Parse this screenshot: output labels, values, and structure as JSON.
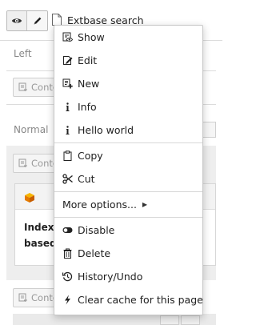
{
  "toolbar": {
    "page_title": "Extbase search",
    "buttons": [
      "eye-icon",
      "pencil-icon"
    ]
  },
  "columns": {
    "left_label": "Left",
    "normal_label": "Normal",
    "content_button_label": "Content"
  },
  "element": {
    "text_line1": "Indexe",
    "text_line2": "based"
  },
  "context_menu": {
    "items": [
      {
        "label": "Show",
        "icon": "show-icon"
      },
      {
        "label": "Edit",
        "icon": "edit-icon"
      },
      {
        "label": "New",
        "icon": "new-icon"
      },
      {
        "label": "Info",
        "icon": "info-icon"
      },
      {
        "label": "Hello world",
        "icon": "info-icon"
      },
      {
        "label": "Copy",
        "icon": "copy-icon"
      },
      {
        "label": "Cut",
        "icon": "cut-icon"
      },
      {
        "label": "More options...",
        "icon": "chevron-right-icon"
      },
      {
        "label": "Disable",
        "icon": "toggle-icon"
      },
      {
        "label": "Delete",
        "icon": "trash-icon"
      },
      {
        "label": "History/Undo",
        "icon": "history-icon"
      },
      {
        "label": "Clear cache for this page",
        "icon": "bolt-icon"
      }
    ]
  }
}
